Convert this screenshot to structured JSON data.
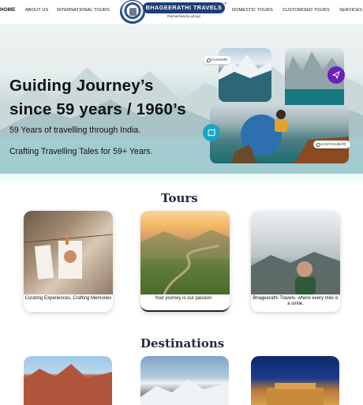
{
  "nav": {
    "home": "HOME",
    "about": "ABOUT US",
    "international": "INTERNATIONAL TOURS",
    "domestic": "DOMESTIC TOURS",
    "customised": "CUSTOMISED TOURS",
    "services": "SERVICES"
  },
  "logo": {
    "name": "BHAGEERATHI TRAVELS",
    "tagline": "Ramachandra group",
    "registered": "®"
  },
  "hero": {
    "title_line1": "Guiding Journey’s",
    "title_line2": "since 59 years / 1960’s",
    "subtitle1": "59 Years of travelling through India.",
    "subtitle2": "Crafting Travelling Tales for 59+ Years.",
    "tag_kashmir": "KASHMIR",
    "tag_kanyakumari": "KANYAKUMARI"
  },
  "tours": {
    "title": "Tours",
    "cards": [
      {
        "caption": "Curating Experiences, Crafting Memories"
      },
      {
        "caption": "Your journey is our passion"
      },
      {
        "caption": "Bhageerathi Travels- where every mile is a smile."
      }
    ]
  },
  "destinations": {
    "title": "Destinations"
  },
  "colors": {
    "brand_blue": "#1d3f78",
    "accent_purple": "#6b21b8",
    "accent_cyan": "#1aa3c7"
  }
}
